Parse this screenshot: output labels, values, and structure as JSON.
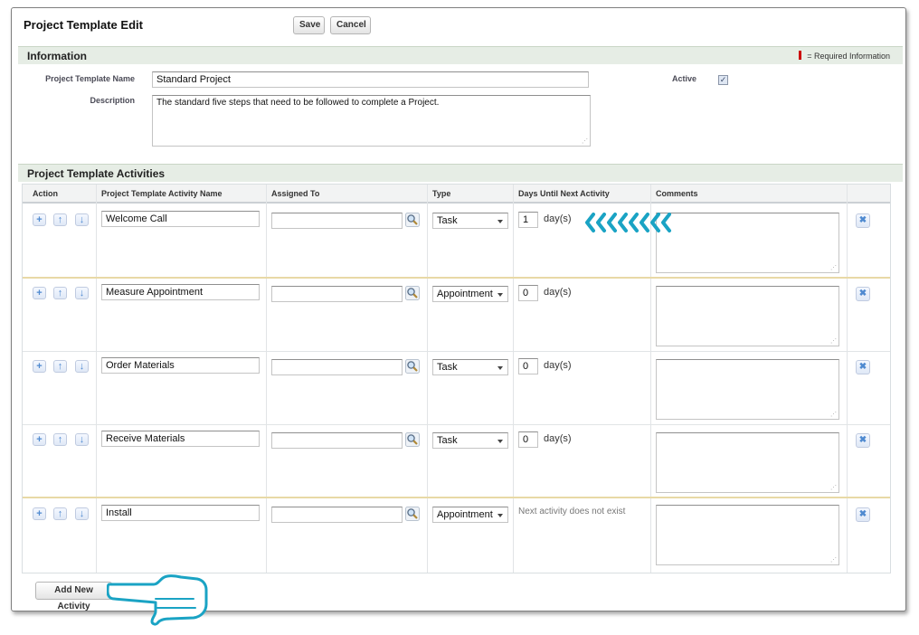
{
  "page": {
    "title": "Project Template Edit",
    "save_label": "Save",
    "cancel_label": "Cancel"
  },
  "information": {
    "section_title": "Information",
    "required_legend": "= Required Information",
    "name_label": "Project Template Name",
    "name_value": "Standard Project",
    "description_label": "Description",
    "description_value": "The standard five steps that need to be followed to complete a Project.",
    "active_label": "Active",
    "active_checked": true
  },
  "activities": {
    "section_title": "Project Template Activities",
    "columns": {
      "action": "Action",
      "name": "Project Template Activity Name",
      "assigned": "Assigned To",
      "type": "Type",
      "days": "Days Until Next Activity",
      "comments": "Comments"
    },
    "rows": [
      {
        "name": "Welcome Call",
        "assigned": "",
        "type": "Task",
        "days": "1",
        "unit": "day(s)",
        "next_text": "",
        "comments": ""
      },
      {
        "name": "Measure Appointment",
        "assigned": "",
        "type": "Appointment",
        "days": "0",
        "unit": "day(s)",
        "next_text": "",
        "comments": ""
      },
      {
        "name": "Order Materials",
        "assigned": "",
        "type": "Task",
        "days": "0",
        "unit": "day(s)",
        "next_text": "",
        "comments": ""
      },
      {
        "name": "Receive Materials",
        "assigned": "",
        "type": "Task",
        "days": "0",
        "unit": "day(s)",
        "next_text": "",
        "comments": ""
      },
      {
        "name": "Install",
        "assigned": "",
        "type": "Appointment",
        "days": "",
        "unit": "",
        "next_text": "Next activity does not exist",
        "comments": ""
      }
    ],
    "add_label": "Add New Activity"
  },
  "icons": {
    "add_row": "plus-icon",
    "move_up": "arrow-up-icon",
    "move_down": "arrow-down-icon",
    "lookup": "magnifier-icon",
    "delete_row": "close-icon",
    "callout_arrows": "chevrons-left-icon",
    "callout_hand": "pointing-hand-icon"
  },
  "colors": {
    "section_bar": "#e6ede5",
    "required_marker": "#cc0000",
    "icon_blue": "#4f8ad0",
    "annotation_teal": "#1aa3c4"
  }
}
